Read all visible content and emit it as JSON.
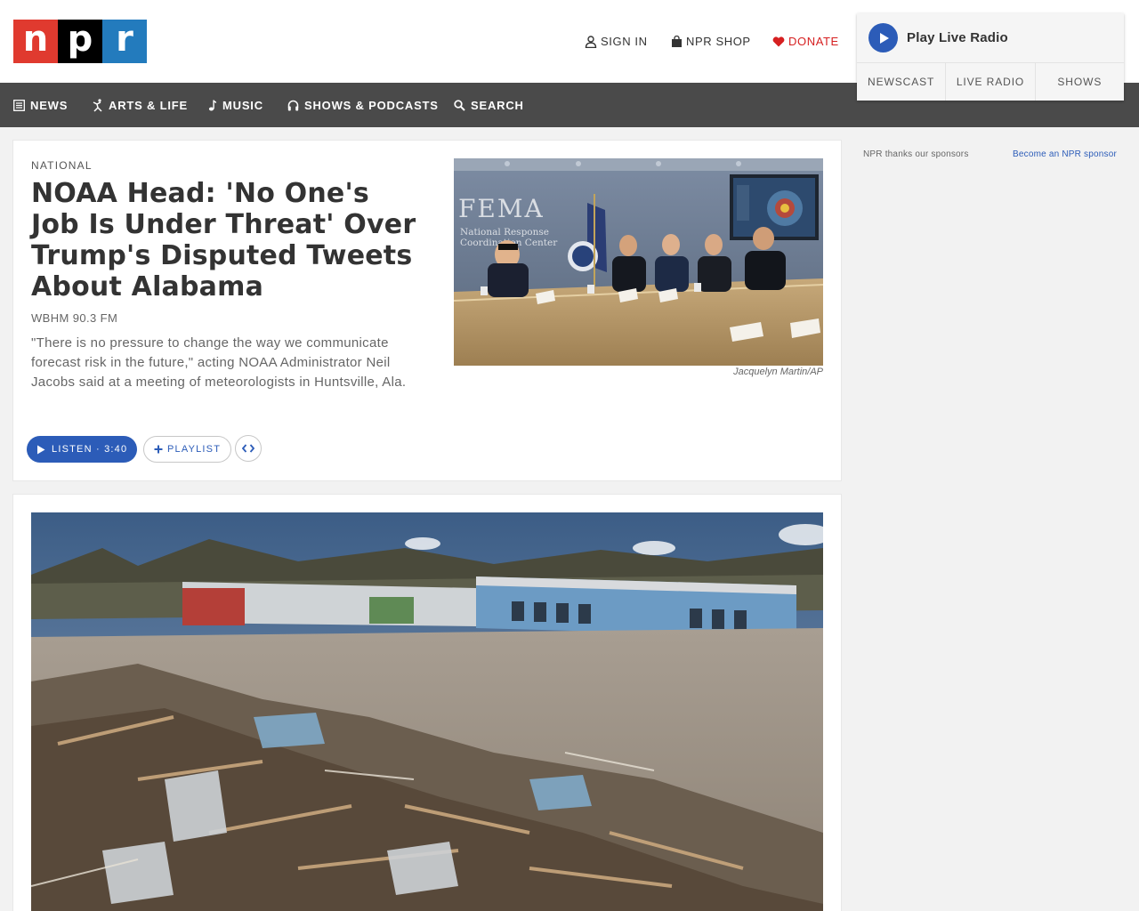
{
  "logo": {
    "letters": [
      "n",
      "p",
      "r"
    ],
    "colors": [
      "#e03a2f",
      "#000000",
      "#237bbd"
    ]
  },
  "utility": {
    "sign_in": "SIGN IN",
    "shop": "NPR SHOP",
    "donate": "DONATE"
  },
  "player": {
    "title": "Play Live Radio",
    "tabs": [
      "NEWSCAST",
      "LIVE RADIO",
      "SHOWS"
    ]
  },
  "nav": {
    "items": [
      {
        "label": "NEWS",
        "icon": "news-icon"
      },
      {
        "label": "ARTS & LIFE",
        "icon": "arts-icon"
      },
      {
        "label": "MUSIC",
        "icon": "music-note-icon"
      },
      {
        "label": "SHOWS & PODCASTS",
        "icon": "headphones-icon"
      },
      {
        "label": "SEARCH",
        "icon": "search-icon"
      }
    ]
  },
  "story1": {
    "slug": "NATIONAL",
    "headline": "NOAA Head: 'No One's Job Is Under Threat' Over Trump's Disputed Tweets About Alabama",
    "station": "WBHM 90.3 FM",
    "teaser": "\"There is no pressure to change the way we communicate forecast risk in the future,\" acting NOAA Administrator Neil Jacobs said at a meeting of meteorologists in Huntsville, Ala.",
    "listen_label": "LISTEN · 3:40",
    "playlist_label": "PLAYLIST",
    "image_text": {
      "title": "FEMA",
      "subtitle_line1": "National Response",
      "subtitle_line2": "Coordination Center"
    },
    "photo_credit": "Jacquelyn Martin/AP"
  },
  "sidebar": {
    "sponsor_thanks": "NPR thanks our sponsors",
    "become_sponsor": "Become an NPR sponsor"
  },
  "colors": {
    "nav_bg": "#4a4a4a",
    "accent_blue": "#2c5cb8",
    "donate_red": "#d62021",
    "page_bg": "#f2f2f2"
  }
}
